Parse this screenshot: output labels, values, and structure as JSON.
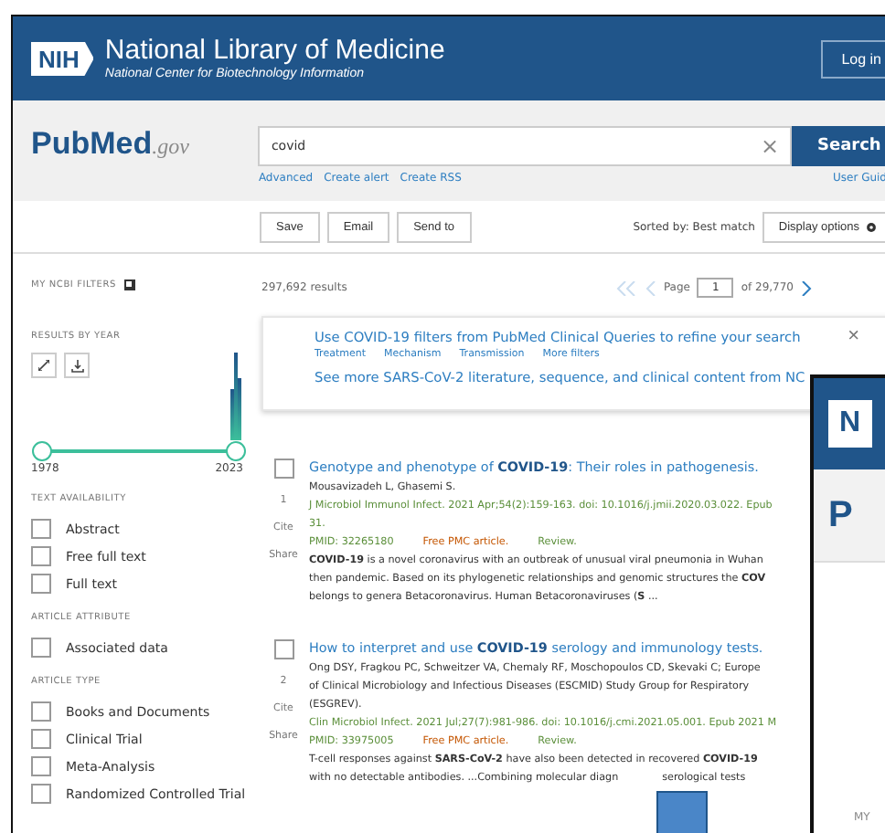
{
  "header": {
    "logo": "NIH",
    "title": "National Library of Medicine",
    "subtitle": "National Center for Biotechnology Information",
    "login": "Log in"
  },
  "search": {
    "brand": "Pub",
    "brand2": "Med",
    "brand_suffix": ".gov",
    "value": "covid",
    "clear": "×",
    "button": "Search",
    "links": [
      "Advanced",
      "Create alert",
      "Create RSS"
    ],
    "guide": "User Guid"
  },
  "toolbar": {
    "buttons": [
      "Save",
      "Email",
      "Send to"
    ],
    "sort": "Sorted by: Best match",
    "display": "Display options"
  },
  "sidebar": {
    "filters_title": "MY NCBI FILTERS",
    "years_title": "RESULTS BY YEAR",
    "year_from": "1978",
    "year_to": "2023",
    "year_range": {
      "level": 1
    },
    "sections": [
      {
        "title": "TEXT AVAILABILITY",
        "items": [
          {
            "label": "Abstract",
            "checked": false
          },
          {
            "label": "Free full text",
            "checked": false
          },
          {
            "label": "Full text",
            "checked": false
          }
        ]
      },
      {
        "title": "ARTICLE ATTRIBUTE",
        "items": [
          {
            "label": "Associated data",
            "checked": false
          }
        ]
      },
      {
        "title": "ARTICLE TYPE",
        "items": [
          {
            "label": "Books and Documents",
            "checked": false
          },
          {
            "label": "Clinical Trial",
            "checked": false
          },
          {
            "label": "Meta-Analysis",
            "checked": false
          },
          {
            "label": "Randomized Controlled Trial",
            "checked": false
          }
        ]
      }
    ]
  },
  "results": {
    "count": "297,692 results",
    "page_label": "Page",
    "page": "1",
    "page_total": "of 29,770"
  },
  "banner": {
    "headline": "Use COVID-19 filters from PubMed Clinical Queries to refine your search",
    "links": [
      "Treatment",
      "Mechanism",
      "Transmission",
      "More filters"
    ],
    "more": "See more SARS-CoV-2 literature, sequence, and clinical content from NC",
    "close": "×"
  },
  "articles": [
    {
      "number": "1",
      "cite": "Cite",
      "share": "Share",
      "checked": false,
      "title": "Genotype and phenotype of **COVID-19**: Their roles in pathogenesis.",
      "authors": [
        "Mousavizadeh L, Ghasemi S."
      ],
      "citation": [
        "J Microbiol Immunol Infect. 2021 Apr;54(2):159-163. doi: 10.1016/j.jmii.2020.03.022. Epub",
        "31."
      ],
      "pmid": "PMID: 32265180",
      "free": "Free PMC article.",
      "type": "Review.",
      "abstract": [
        [
          "**COVID-19** is a novel coronavirus with an outbreak of unusual viral pneumonia in Wuhan"
        ],
        [
          "then pandemic. Based on its phylogenetic relationships and genomic structures the **COV**"
        ],
        [
          "belongs to genera Betacoronavirus. Human Betacoronaviruses (**S** ..."
        ]
      ]
    },
    {
      "number": "2",
      "cite": "Cite",
      "share": "Share",
      "checked": false,
      "title": "How to interpret and use **COVID-19** serology and immunology tests.",
      "authors": [
        "Ong DSY, Fragkou PC, Schweitzer VA, Chemaly RF, Moschopoulos CD, Skevaki C; Europe",
        "of Clinical Microbiology and Infectious Diseases (ESCMID) Study Group for Respiratory",
        "(ESGREV)."
      ],
      "citation": [
        "Clin Microbiol Infect. 2021 Jul;27(7):981-986. doi: 10.1016/j.cmi.2021.05.001. Epub 2021 M"
      ],
      "pmid": "PMID: 33975005",
      "free": "Free PMC article.",
      "type": "Review.",
      "abstract": [
        [
          "T-cell responses against **SARS-CoV-2** have also been detected in recovered **COVID-19**"
        ],
        [
          "with no detectable antibodies. ...Combining molecular diagn",
          "serological tests"
        ]
      ]
    }
  ],
  "overlay_window": {
    "logo": "N",
    "brand": "P",
    "label": "MY"
  }
}
